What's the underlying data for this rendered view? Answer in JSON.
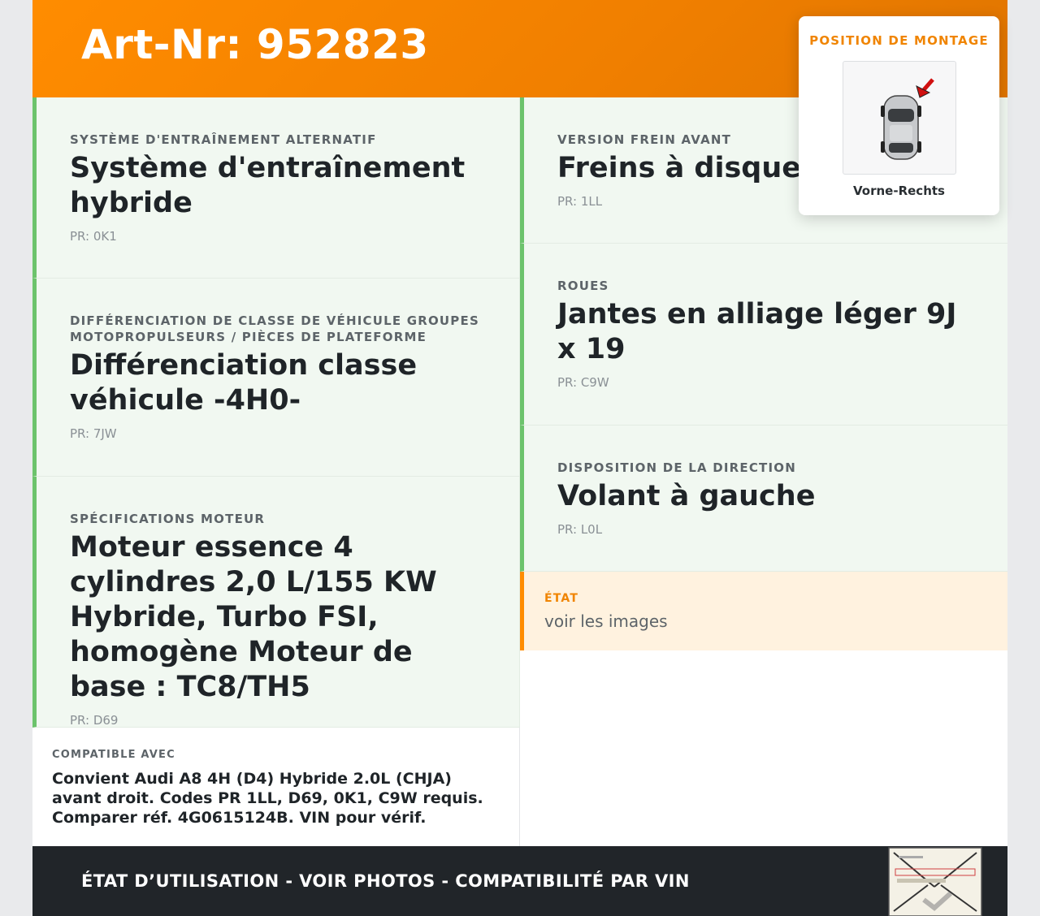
{
  "header": {
    "title": "Art-Nr: 952823"
  },
  "left_cards": [
    {
      "label": "SYSTÈME D'ENTRAÎNEMENT ALTERNATIF",
      "value": "Système d'entraînement hybride",
      "code": "PR: 0K1"
    },
    {
      "label": "DIFFÉRENCIATION DE CLASSE DE VÉHICULE GROUPES MOTOPROPULSEURS / PIÈCES DE PLATEFORME",
      "value": "Différenciation classe véhicule -4H0-",
      "code": "PR: 7JW"
    },
    {
      "label": "SPÉCIFICATIONS MOTEUR",
      "value": "Moteur essence 4 cylindres 2,0 L/155 KW Hybride, Turbo FSI, homogène Moteur de base : TC8/TH5",
      "code": "PR: D69"
    }
  ],
  "right_cards": [
    {
      "label": "VERSION FREIN AVANT",
      "value": "Freins à disque av",
      "code": "PR: 1LL"
    },
    {
      "label": "ROUES",
      "value": "Jantes en alliage léger 9J x 19",
      "code": "PR: C9W"
    },
    {
      "label": "DISPOSITION DE LA DIRECTION",
      "value": "Volant à gauche",
      "code": "PR: L0L"
    }
  ],
  "etat": {
    "label": "ÉTAT",
    "value": "voir les images"
  },
  "compat": {
    "label": "COMPATIBLE AVEC",
    "value": "Convient Audi A8 4H (D4) Hybride 2.0L (CHJA) avant droit. Codes PR 1LL, D69, 0K1, C9W requis. Comparer réf. 4G0615124B. VIN pour vérif."
  },
  "footer": {
    "text": "ÉTAT D’UTILISATION - VOIR PHOTOS - COMPATIBILITÉ PAR VIN"
  },
  "popup": {
    "title": "POSITION DE MONTAGE",
    "position": "Vorne-Rechts"
  },
  "colors": {
    "accent": "#ff8c00",
    "green": "#6cc36c",
    "dark": "#212529"
  }
}
